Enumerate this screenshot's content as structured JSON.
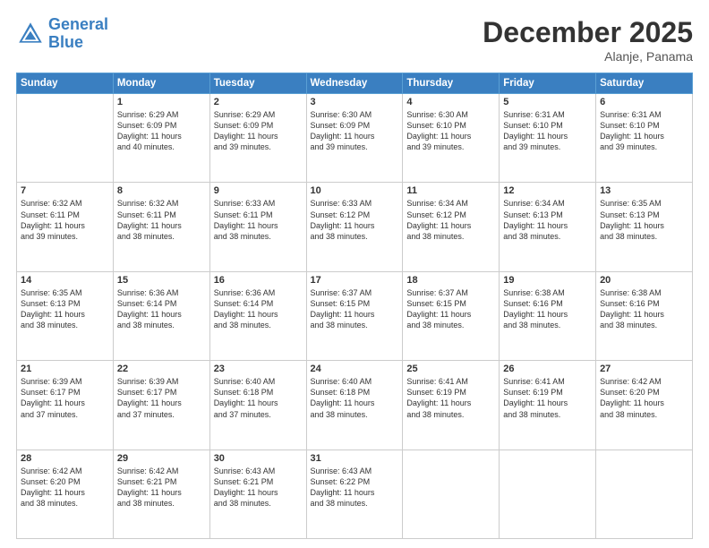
{
  "header": {
    "logo_line1": "General",
    "logo_line2": "Blue",
    "month": "December 2025",
    "location": "Alanje, Panama"
  },
  "weekdays": [
    "Sunday",
    "Monday",
    "Tuesday",
    "Wednesday",
    "Thursday",
    "Friday",
    "Saturday"
  ],
  "weeks": [
    [
      {
        "day": "",
        "info": ""
      },
      {
        "day": "1",
        "info": "Sunrise: 6:29 AM\nSunset: 6:09 PM\nDaylight: 11 hours\nand 40 minutes."
      },
      {
        "day": "2",
        "info": "Sunrise: 6:29 AM\nSunset: 6:09 PM\nDaylight: 11 hours\nand 39 minutes."
      },
      {
        "day": "3",
        "info": "Sunrise: 6:30 AM\nSunset: 6:09 PM\nDaylight: 11 hours\nand 39 minutes."
      },
      {
        "day": "4",
        "info": "Sunrise: 6:30 AM\nSunset: 6:10 PM\nDaylight: 11 hours\nand 39 minutes."
      },
      {
        "day": "5",
        "info": "Sunrise: 6:31 AM\nSunset: 6:10 PM\nDaylight: 11 hours\nand 39 minutes."
      },
      {
        "day": "6",
        "info": "Sunrise: 6:31 AM\nSunset: 6:10 PM\nDaylight: 11 hours\nand 39 minutes."
      }
    ],
    [
      {
        "day": "7",
        "info": "Sunrise: 6:32 AM\nSunset: 6:11 PM\nDaylight: 11 hours\nand 39 minutes."
      },
      {
        "day": "8",
        "info": "Sunrise: 6:32 AM\nSunset: 6:11 PM\nDaylight: 11 hours\nand 38 minutes."
      },
      {
        "day": "9",
        "info": "Sunrise: 6:33 AM\nSunset: 6:11 PM\nDaylight: 11 hours\nand 38 minutes."
      },
      {
        "day": "10",
        "info": "Sunrise: 6:33 AM\nSunset: 6:12 PM\nDaylight: 11 hours\nand 38 minutes."
      },
      {
        "day": "11",
        "info": "Sunrise: 6:34 AM\nSunset: 6:12 PM\nDaylight: 11 hours\nand 38 minutes."
      },
      {
        "day": "12",
        "info": "Sunrise: 6:34 AM\nSunset: 6:13 PM\nDaylight: 11 hours\nand 38 minutes."
      },
      {
        "day": "13",
        "info": "Sunrise: 6:35 AM\nSunset: 6:13 PM\nDaylight: 11 hours\nand 38 minutes."
      }
    ],
    [
      {
        "day": "14",
        "info": "Sunrise: 6:35 AM\nSunset: 6:13 PM\nDaylight: 11 hours\nand 38 minutes."
      },
      {
        "day": "15",
        "info": "Sunrise: 6:36 AM\nSunset: 6:14 PM\nDaylight: 11 hours\nand 38 minutes."
      },
      {
        "day": "16",
        "info": "Sunrise: 6:36 AM\nSunset: 6:14 PM\nDaylight: 11 hours\nand 38 minutes."
      },
      {
        "day": "17",
        "info": "Sunrise: 6:37 AM\nSunset: 6:15 PM\nDaylight: 11 hours\nand 38 minutes."
      },
      {
        "day": "18",
        "info": "Sunrise: 6:37 AM\nSunset: 6:15 PM\nDaylight: 11 hours\nand 38 minutes."
      },
      {
        "day": "19",
        "info": "Sunrise: 6:38 AM\nSunset: 6:16 PM\nDaylight: 11 hours\nand 38 minutes."
      },
      {
        "day": "20",
        "info": "Sunrise: 6:38 AM\nSunset: 6:16 PM\nDaylight: 11 hours\nand 38 minutes."
      }
    ],
    [
      {
        "day": "21",
        "info": "Sunrise: 6:39 AM\nSunset: 6:17 PM\nDaylight: 11 hours\nand 37 minutes."
      },
      {
        "day": "22",
        "info": "Sunrise: 6:39 AM\nSunset: 6:17 PM\nDaylight: 11 hours\nand 37 minutes."
      },
      {
        "day": "23",
        "info": "Sunrise: 6:40 AM\nSunset: 6:18 PM\nDaylight: 11 hours\nand 37 minutes."
      },
      {
        "day": "24",
        "info": "Sunrise: 6:40 AM\nSunset: 6:18 PM\nDaylight: 11 hours\nand 38 minutes."
      },
      {
        "day": "25",
        "info": "Sunrise: 6:41 AM\nSunset: 6:19 PM\nDaylight: 11 hours\nand 38 minutes."
      },
      {
        "day": "26",
        "info": "Sunrise: 6:41 AM\nSunset: 6:19 PM\nDaylight: 11 hours\nand 38 minutes."
      },
      {
        "day": "27",
        "info": "Sunrise: 6:42 AM\nSunset: 6:20 PM\nDaylight: 11 hours\nand 38 minutes."
      }
    ],
    [
      {
        "day": "28",
        "info": "Sunrise: 6:42 AM\nSunset: 6:20 PM\nDaylight: 11 hours\nand 38 minutes."
      },
      {
        "day": "29",
        "info": "Sunrise: 6:42 AM\nSunset: 6:21 PM\nDaylight: 11 hours\nand 38 minutes."
      },
      {
        "day": "30",
        "info": "Sunrise: 6:43 AM\nSunset: 6:21 PM\nDaylight: 11 hours\nand 38 minutes."
      },
      {
        "day": "31",
        "info": "Sunrise: 6:43 AM\nSunset: 6:22 PM\nDaylight: 11 hours\nand 38 minutes."
      },
      {
        "day": "",
        "info": ""
      },
      {
        "day": "",
        "info": ""
      },
      {
        "day": "",
        "info": ""
      }
    ]
  ]
}
